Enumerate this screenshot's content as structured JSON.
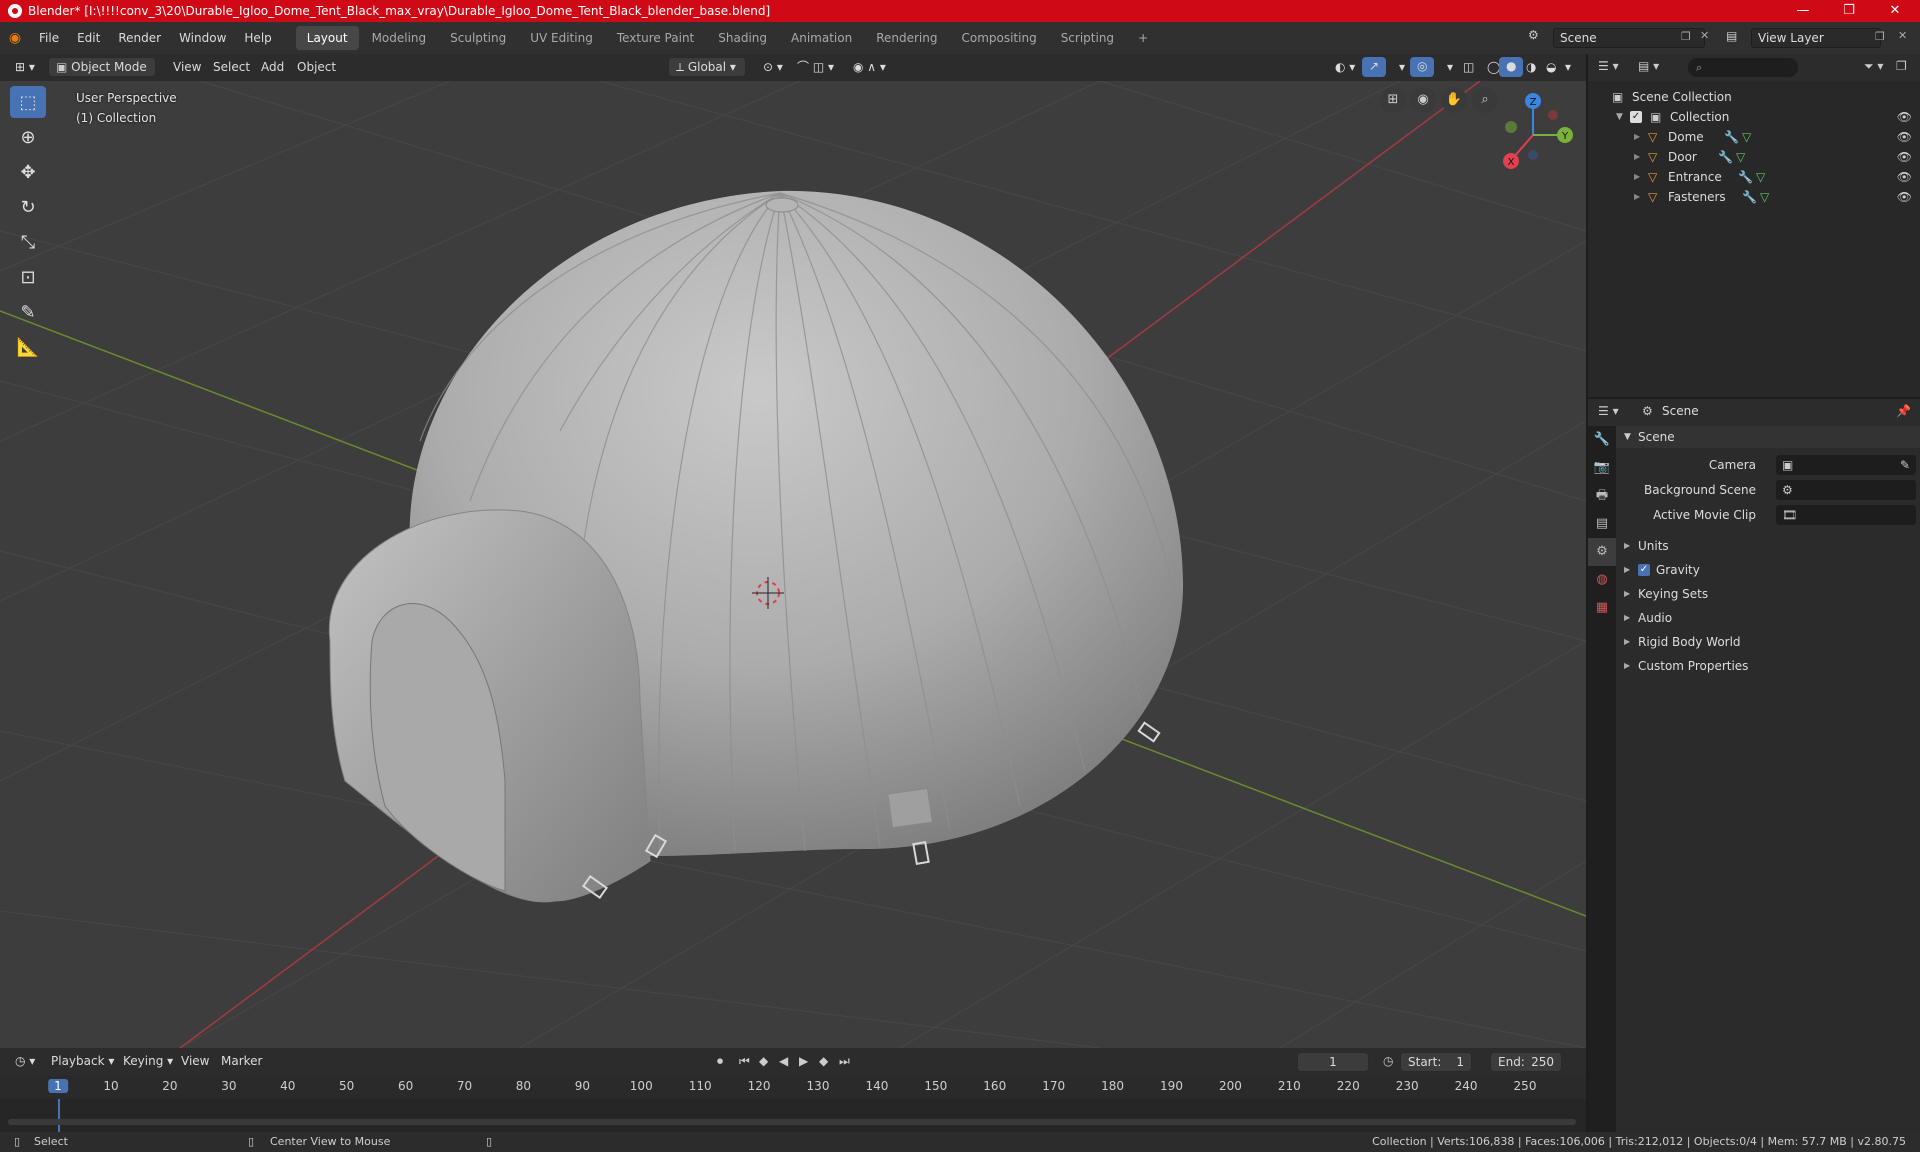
{
  "window": {
    "title": "Blender* [I:\\!!!!conv_3\\20\\Durable_Igloo_Dome_Tent_Black_max_vray\\Durable_Igloo_Dome_Tent_Black_blender_base.blend]",
    "min": "—",
    "max": "❐",
    "close": "✕"
  },
  "menu": [
    "File",
    "Edit",
    "Render",
    "Window",
    "Help"
  ],
  "workspaces": [
    "Layout",
    "Modeling",
    "Sculpting",
    "UV Editing",
    "Texture Paint",
    "Shading",
    "Animation",
    "Rendering",
    "Compositing",
    "Scripting"
  ],
  "active_workspace": "Layout",
  "add_workspace": "+",
  "scene_field": "Scene",
  "view_layer_field": "View Layer",
  "viewport": {
    "mode": "Object Mode",
    "menus": [
      "View",
      "Select",
      "Add",
      "Object"
    ],
    "orientation": "Global",
    "perspective_label": "User Perspective",
    "collection_label": "(1) Collection",
    "gizmo": {
      "x": "X",
      "y": "Y",
      "z": "Z",
      "x_color": "#e0404f",
      "y_color": "#7ab13a",
      "z_color": "#3b86e0"
    }
  },
  "outliner": {
    "root": "Scene Collection",
    "collection": "Collection",
    "objects": [
      "Dome",
      "Door",
      "Entrance",
      "Fasteners"
    ]
  },
  "properties": {
    "header": "Scene",
    "panel": "Scene",
    "fields": [
      {
        "label": "Camera"
      },
      {
        "label": "Background Scene"
      },
      {
        "label": "Active Movie Clip"
      }
    ],
    "sections": [
      "Units",
      "Gravity",
      "Keying Sets",
      "Audio",
      "Rigid Body World",
      "Custom Properties"
    ]
  },
  "timeline": {
    "menus": [
      "Playback",
      "Keying",
      "View",
      "Marker"
    ],
    "current_frame": "1",
    "start_label": "Start:",
    "start": "1",
    "end_label": "End:",
    "end": "250",
    "ticks": [
      "1",
      "10",
      "20",
      "30",
      "40",
      "50",
      "60",
      "70",
      "80",
      "90",
      "100",
      "110",
      "120",
      "130",
      "140",
      "150",
      "160",
      "170",
      "180",
      "190",
      "200",
      "210",
      "220",
      "230",
      "240",
      "250"
    ]
  },
  "status": {
    "left": "Select",
    "middle": "Center View to Mouse",
    "right": "Collection | Verts:106,838 | Faces:106,006 | Tris:212,012 | Objects:0/4 | Mem: 57.7 MB | v2.80.75"
  },
  "colors": {
    "accent": "#4772b3",
    "title_bar": "#cf0a16",
    "object_icon": "#e39b3c",
    "data_icon": "#5fc26d"
  }
}
